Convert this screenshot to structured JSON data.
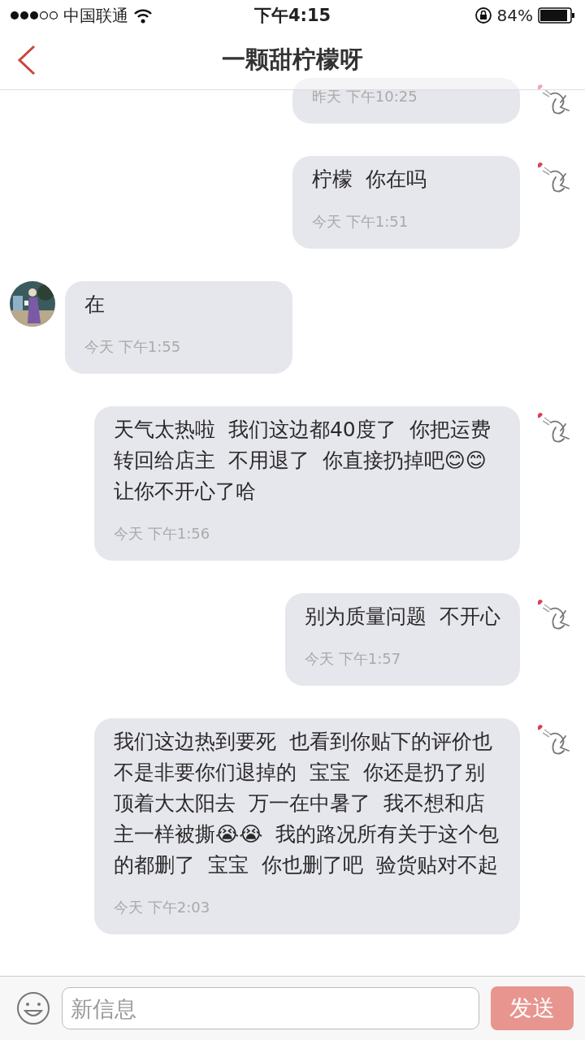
{
  "status_bar": {
    "carrier": "中国联通",
    "time": "下午4:15",
    "battery": "84%"
  },
  "header": {
    "title": "一颗甜柠檬呀"
  },
  "messages": [
    {
      "kind": "outgoing",
      "time": "昨天 下午10:25"
    },
    {
      "kind": "outgoing",
      "text": "柠檬  你在吗",
      "time": "今天 下午1:51"
    },
    {
      "kind": "incoming",
      "text": "在",
      "time": "今天 下午1:55"
    },
    {
      "kind": "outgoing",
      "text": "天气太热啦  我们这边都40度了  你把运费转回给店主  不用退了  你直接扔掉吧😊😊让你不开心了哈",
      "time": "今天 下午1:56"
    },
    {
      "kind": "outgoing",
      "text": "别为质量问题  不开心",
      "time": "今天 下午1:57"
    },
    {
      "kind": "outgoing",
      "text": "我们这边热到要死  也看到你贴下的评价也不是非要你们退掉的  宝宝  你还是扔了别顶着大太阳去  万一在中暑了  我不想和店主一样被撕😭😭  我的路况所有关于这个包的都删了  宝宝  你也删了吧  验货贴对不起",
      "time": "今天 下午2:03"
    }
  ],
  "composer": {
    "placeholder": "新信息",
    "send": "发送"
  }
}
